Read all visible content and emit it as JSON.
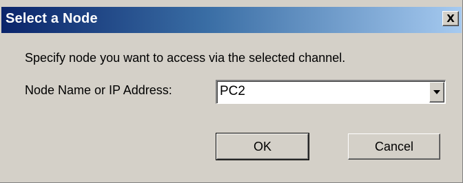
{
  "dialog": {
    "title": "Select a Node",
    "close_label": "X",
    "message": "Specify node you want to access via the selected channel.",
    "field_label": "Node Name or IP Address:",
    "node_value": "PC2",
    "ok_label": "OK",
    "cancel_label": "Cancel"
  },
  "icons": {
    "close": "close-icon",
    "dropdown": "chevron-down-icon"
  },
  "colors": {
    "titlebar_start": "#0a246a",
    "titlebar_end": "#a6caf0",
    "dialog_face": "#d4d0c8"
  }
}
